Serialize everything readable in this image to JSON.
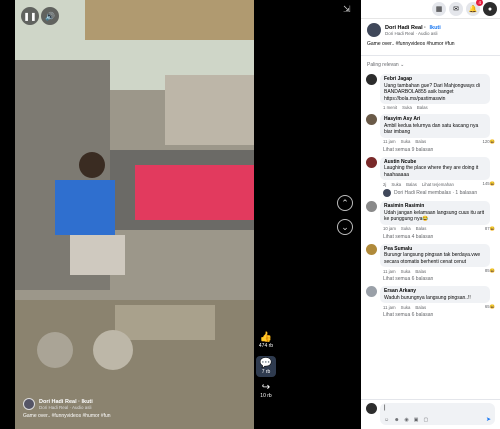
{
  "video": {
    "author": "Dori Hadi Real",
    "follow": "Ikuti",
    "audio": "Dori Hadi Real · Audio asli",
    "caption": "Game over.. #funnyvideos #humor #fun",
    "likes": "474 rb",
    "comments": "7 rb",
    "shares": "10 rb"
  },
  "post": {
    "author": "Dori Hadi Real",
    "follow": "Ikuti",
    "sub": "Dori Hadi Real · Audio asli",
    "caption": "Game over.. #funnyvideos #humor #fun"
  },
  "sort_label": "Paling relevan ⌄",
  "comments": [
    {
      "name": "Febri Jagap",
      "text": "Uang tambahan gue? Dari Mahjongways di BANDARBOLA855 asik banget https://bola.ms/pastimaswin",
      "time": "1 menit",
      "like": "Suka",
      "reply": "Balas",
      "count": "",
      "color": "#2c2c2c"
    },
    {
      "name": "Hasyim Asy Ari",
      "text": "Ambil kedua telurnya dan satu kacang nya biar imbang",
      "time": "11 jam",
      "like": "Suka",
      "reply": "Balas",
      "count": "120",
      "color": "#6a5a48",
      "more": "Lihat semua 9 balasan"
    },
    {
      "name": "Austin Ncube",
      "text": "Laughing the place where they are doing it haahaaaaa",
      "time": "2j",
      "like": "Suka",
      "reply": "Balas",
      "extra": "Lihat terjemahan",
      "count": "145",
      "color": "#7a2a2a",
      "sublink": "Dori Hadi Real membalas · 1 balasan"
    },
    {
      "name": "Rasimin Rasimin",
      "text": "Udah jangan kelamaan langsung cuus itu arit ke punggung nya😂",
      "time": "10 jam",
      "like": "Suka",
      "reply": "Balas",
      "count": "87",
      "color": "#8a8a8a",
      "more": "Lihat semua 4 balasan"
    },
    {
      "name": "Pea Sumalu",
      "text": "Burungr langsung pingsan tak berdaya.vwe secara otomatis berhenti cenat cenut",
      "time": "11 jam",
      "like": "Suka",
      "reply": "Balas",
      "count": "85",
      "color": "#b08a3a",
      "more": "Lihat semua 6 balasan"
    },
    {
      "name": "Ersan Arkany",
      "text": "Waduh burungnya langsung pingsan..!!",
      "time": "11 jam",
      "like": "Suka",
      "reply": "Balas",
      "count": "65",
      "color": "#9aa0a8",
      "more": "Lihat semua 6 balasan"
    }
  ],
  "compose": {
    "value": "|"
  }
}
